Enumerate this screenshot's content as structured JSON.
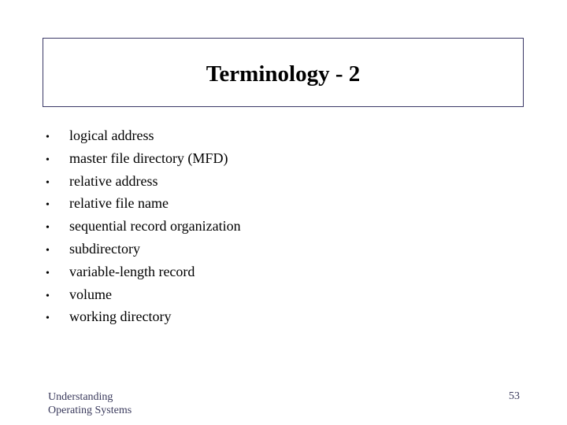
{
  "title": "Terminology - 2",
  "bullet_glyph": "•",
  "items": [
    "logical address",
    "master file directory (MFD)",
    "relative address",
    "relative file name",
    "sequential record organization",
    "subdirectory",
    "variable-length record",
    "volume",
    "working directory"
  ],
  "footer": {
    "line1": "Understanding",
    "line2": "Operating Systems",
    "page_number": "53"
  }
}
